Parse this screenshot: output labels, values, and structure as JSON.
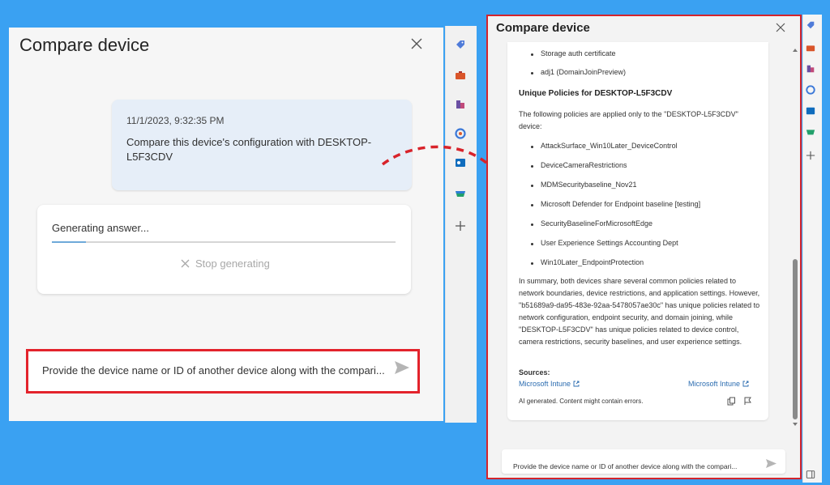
{
  "left_panel": {
    "title": "Compare device",
    "message": {
      "timestamp": "11/1/2023, 9:32:35 PM",
      "text": "Compare this device's configuration with DESKTOP-L5F3CDV"
    },
    "generating": {
      "text": "Generating answer...",
      "progress": 0.1,
      "stop_label": "Stop generating"
    },
    "input_placeholder": "Provide the device name or ID of another device along with the compari..."
  },
  "right_panel": {
    "title": "Compare device",
    "top_items": [
      "Storage auth certificate",
      "adj1 (DomainJoinPreview)"
    ],
    "unique_heading": "Unique Policies for DESKTOP-L5F3CDV",
    "intro_text": "The following policies are applied only to the \"DESKTOP-L5F3CDV\" device:",
    "policies": [
      "AttackSurface_Win10Later_DeviceControl",
      "DeviceCameraRestrictions",
      "MDMSecuritybaseline_Nov21",
      "Microsoft Defender for Endpoint baseline [testing]",
      "SecurityBaselineForMicrosoftEdge",
      "User Experience Settings Accounting Dept",
      "Win10Later_EndpointProtection"
    ],
    "summary": "In summary, both devices share several common policies related to network boundaries, device restrictions, and application settings. However, \"b51689a9-da95-483e-92aa-5478057ae30c\" has unique policies related to network configuration, endpoint security, and domain joining, while \"DESKTOP-L5F3CDV\" has unique policies related to device control, camera restrictions, security baselines, and user experience settings.",
    "sources_label": "Sources:",
    "sources": [
      "Microsoft Intune",
      "Microsoft Intune"
    ],
    "ai_note": "AI generated. Content might contain errors.",
    "input_placeholder": "Provide the device name or ID of another device along with the compari..."
  },
  "rail_icons": [
    "tag-icon",
    "toolbox-icon",
    "chess-icon",
    "office-icon",
    "outlook-icon",
    "shopping-icon",
    "plus-icon"
  ],
  "colors": {
    "background": "#3aa1f2",
    "highlight_border": "#e3232c",
    "arrow": "#d8232a",
    "link": "#2b6cb0"
  }
}
